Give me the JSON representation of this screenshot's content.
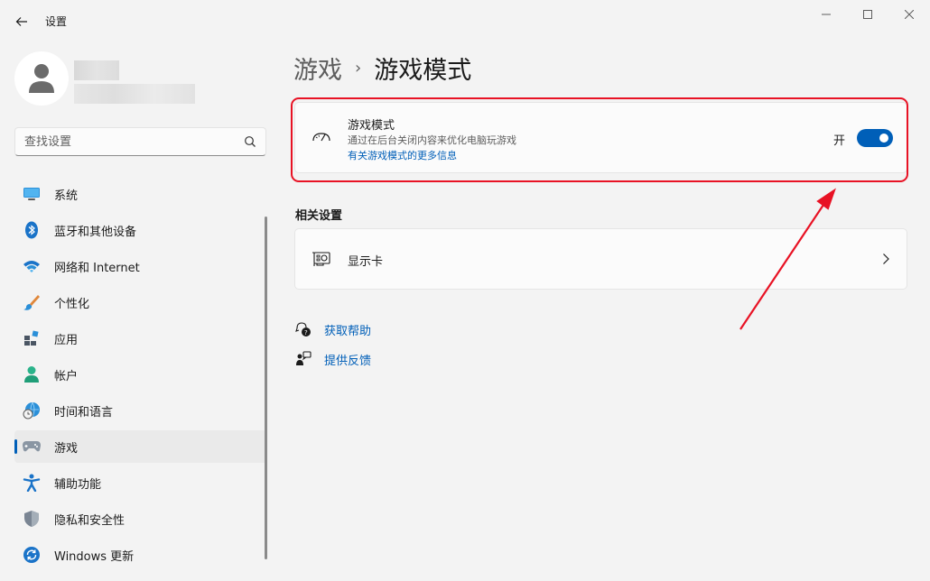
{
  "window": {
    "title": "设置",
    "back_icon": "back-arrow-icon",
    "minimize_icon": "minimize-icon",
    "maximize_icon": "maximize-icon",
    "close_icon": "close-icon"
  },
  "search": {
    "placeholder": "查找设置",
    "icon": "search-icon"
  },
  "sidebar": {
    "items": [
      {
        "label": "系统",
        "icon": "monitor-icon",
        "active": false
      },
      {
        "label": "蓝牙和其他设备",
        "icon": "bluetooth-icon",
        "active": false
      },
      {
        "label": "网络和 Internet",
        "icon": "wifi-icon",
        "active": false
      },
      {
        "label": "个性化",
        "icon": "paintbrush-icon",
        "active": false
      },
      {
        "label": "应用",
        "icon": "apps-icon",
        "active": false
      },
      {
        "label": "帐户",
        "icon": "person-icon",
        "active": false
      },
      {
        "label": "时间和语言",
        "icon": "globe-clock-icon",
        "active": false
      },
      {
        "label": "游戏",
        "icon": "gamepad-icon",
        "active": true
      },
      {
        "label": "辅助功能",
        "icon": "accessibility-icon",
        "active": false
      },
      {
        "label": "隐私和安全性",
        "icon": "shield-icon",
        "active": false
      },
      {
        "label": "Windows 更新",
        "icon": "update-icon",
        "active": false
      }
    ]
  },
  "breadcrumb": {
    "parent": "游戏",
    "separator": "›",
    "current": "游戏模式"
  },
  "game_mode_card": {
    "title": "游戏模式",
    "description": "通过在后台关闭内容来优化电脑玩游戏",
    "link": "有关游戏模式的更多信息",
    "toggle_label": "开",
    "toggle_on": true,
    "icon": "gamemode-gauge-icon"
  },
  "related": {
    "title": "相关设置",
    "items": [
      {
        "label": "显示卡",
        "icon": "graphics-card-icon"
      }
    ]
  },
  "help": {
    "get_help": "获取帮助",
    "feedback": "提供反馈"
  },
  "colors": {
    "accent": "#005fb8",
    "highlight": "#e81224",
    "background": "#f3f3f3",
    "card": "#fbfbfb"
  }
}
